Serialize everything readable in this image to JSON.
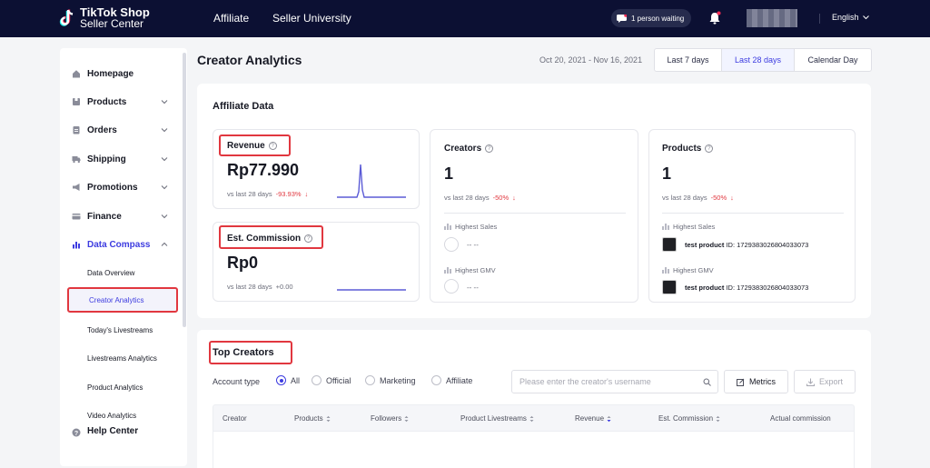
{
  "topbar": {
    "brand_line1": "TikTok Shop",
    "brand_line2": "Seller Center",
    "nav": [
      "Affiliate",
      "Seller University"
    ],
    "chat_status": "1 person waiting",
    "language": "English"
  },
  "sidebar": {
    "items": [
      {
        "label": "Homepage",
        "icon": "home-icon"
      },
      {
        "label": "Products",
        "icon": "box-icon"
      },
      {
        "label": "Orders",
        "icon": "clipboard-icon"
      },
      {
        "label": "Shipping",
        "icon": "truck-icon"
      },
      {
        "label": "Promotions",
        "icon": "megaphone-icon"
      },
      {
        "label": "Finance",
        "icon": "card-icon"
      },
      {
        "label": "Data Compass",
        "icon": "bar-chart-icon"
      }
    ],
    "subitems": [
      "Data Overview",
      "Creator Analytics",
      "Today's Livestreams",
      "Livestreams Analytics",
      "Product Analytics",
      "Video Analytics"
    ],
    "help": "Help Center"
  },
  "header": {
    "title": "Creator Analytics",
    "date_range": "Oct 20, 2021 - Nov 16, 2021",
    "range_buttons": [
      "Last 7 days",
      "Last 28 days",
      "Calendar Day"
    ],
    "active_range": "Last 28 days"
  },
  "affiliate": {
    "title": "Affiliate Data",
    "revenue": {
      "label": "Revenue",
      "value": "Rp77.990",
      "vs": "vs last 28 days",
      "change": "-93.93%"
    },
    "commission": {
      "label": "Est. Commission",
      "value": "Rp0",
      "vs": "vs last 28 days",
      "change": "+0.00"
    },
    "creators": {
      "label": "Creators",
      "value": "1",
      "vs": "vs last 28 days",
      "change": "-50%",
      "highest_sales": "Highest Sales",
      "highest_gmv": "Highest GMV",
      "sales_val": "-- --",
      "gmv_val": "-- --"
    },
    "products": {
      "label": "Products",
      "value": "1",
      "vs": "vs last 28 days",
      "change": "-50%",
      "highest_sales": "Highest Sales",
      "highest_gmv": "Highest GMV",
      "product_name": "test product",
      "id_label": "ID: 1729383026804033073"
    }
  },
  "top_creators": {
    "title": "Top Creators",
    "account_type_label": "Account type",
    "account_types": [
      "All",
      "Official",
      "Marketing",
      "Affiliate"
    ],
    "selected": "All",
    "search_placeholder": "Please enter the creator's username",
    "metrics_label": "Metrics",
    "export_label": "Export",
    "columns": [
      "Creator",
      "Products",
      "Followers",
      "Product Livestreams",
      "Revenue",
      "Est. Commission",
      "Actual commission"
    ]
  },
  "colors": {
    "accent": "#3d3ce0",
    "highlight": "#e1373f",
    "topbar": "#0c1033"
  }
}
